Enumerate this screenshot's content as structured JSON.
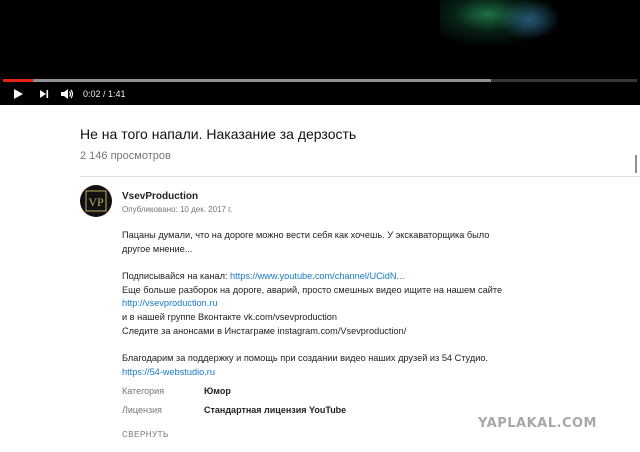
{
  "player": {
    "time_current": "0:02",
    "time_separator": " / ",
    "time_total": "1:41",
    "progress_played": 0.048,
    "progress_buffered": 0.77,
    "colors": {
      "played": "#e62117",
      "background": "#000000"
    },
    "icons": [
      "play-icon",
      "next-icon",
      "volume-icon"
    ]
  },
  "video": {
    "title": "Не на того напали. Наказание за дерзость",
    "views": "2 146 просмотров"
  },
  "channel": {
    "name": "VsevProduction",
    "published": "Опубликовано: 10 дек. 2017 г.",
    "avatar_monogram": "VP"
  },
  "description": {
    "line1": "Пацаны думали, что на дороге можно вести себя как хочешь. У экскаваторщика было",
    "line2": "другое мнение...",
    "subscribe_prefix": "Подписывайся на канал: ",
    "subscribe_link": "https://www.youtube.com/channel/UCidN...",
    "more_text": "Еще больше разборок на дороге, аварий, просто смешных видео ищите на нашем сайте",
    "site_link": "http://vsevproduction.ru",
    "vk_text": "и в нашей группе Вконтакте vk.com/vsevproduction",
    "insta_text": "Следите за анонсами в Инстаграме instagram.com/Vsevproduction/",
    "thanks_text": "Благодарим за поддержку и помощь при создании видео наших друзей из 54 Студио.",
    "studio_link": "https://54-webstudio.ru"
  },
  "meta": {
    "category_label": "Категория",
    "category_value": "Юмор",
    "license_label": "Лицензия",
    "license_value": "Стандартная лицензия YouTube"
  },
  "collapse_label": "СВЕРНУТЬ",
  "watermark": "YAPLAKAL.COM",
  "colors": {
    "link": "#167ac6",
    "secondary_text": "#767676"
  }
}
